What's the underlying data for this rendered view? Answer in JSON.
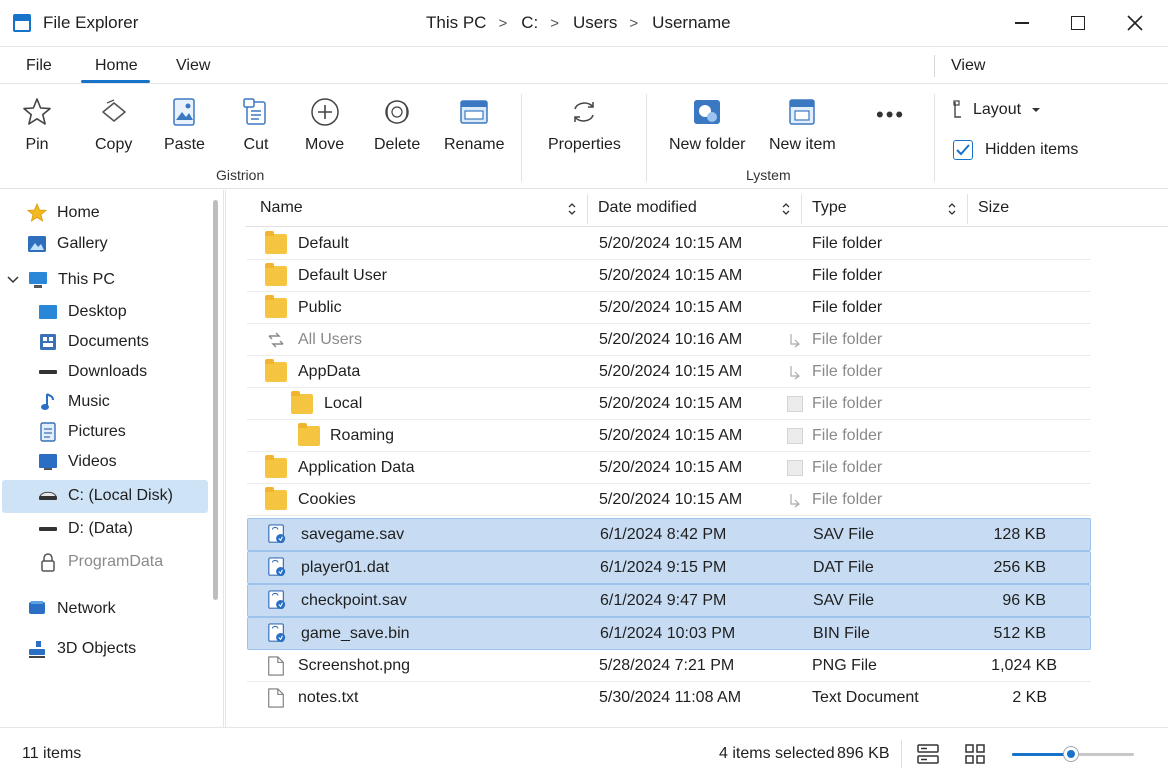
{
  "window": {
    "title": "File Explorer",
    "breadcrumbs": [
      "This PC",
      "C:",
      "Users",
      "Username"
    ],
    "breadcrumb_sep": ">"
  },
  "tabs": {
    "file": "File",
    "home": "Home",
    "view": "View",
    "view_right": "View",
    "active": "Home"
  },
  "ribbon": {
    "buttons": [
      {
        "label": "Pin",
        "icon": "star-icon"
      },
      {
        "label": "Copy",
        "icon": "copy-icon"
      },
      {
        "label": "Paste",
        "icon": "paste-icon"
      },
      {
        "label": "Cut",
        "icon": "cut-icon"
      },
      {
        "label": "Move",
        "icon": "move-icon"
      },
      {
        "label": "Delete",
        "icon": "delete-icon"
      },
      {
        "label": "Rename",
        "icon": "rename-icon"
      },
      {
        "label": "Properties",
        "icon": "properties-icon"
      },
      {
        "label": "New folder",
        "icon": "new-folder-icon"
      },
      {
        "label": "New item",
        "icon": "new-item-icon"
      }
    ],
    "group1_label": "Gistrion",
    "group2_label": "Lystem",
    "more": "•••",
    "layout_label": "Layout",
    "hidden_items_label": "Hidden items",
    "hidden_items_checked": true
  },
  "nav": {
    "items": [
      {
        "label": "Home",
        "icon": "home-star-icon"
      },
      {
        "label": "Gallery",
        "icon": "gallery-icon"
      },
      {
        "label": "This PC",
        "icon": "this-pc-icon"
      },
      {
        "label": "Desktop",
        "icon": "desktop-icon"
      },
      {
        "label": "Documents",
        "icon": "documents-icon"
      },
      {
        "label": "Downloads",
        "icon": "downloads-icon"
      },
      {
        "label": "Music",
        "icon": "music-icon"
      },
      {
        "label": "Pictures",
        "icon": "pictures-icon"
      },
      {
        "label": "Videos",
        "icon": "videos-icon"
      },
      {
        "label": "C: (Local Disk)",
        "icon": "local-disk-icon"
      },
      {
        "label": "D: (Data)",
        "icon": "data-disk-icon"
      },
      {
        "label": "ProgramData",
        "icon": "lock-icon"
      },
      {
        "label": "Network",
        "icon": "network-icon"
      },
      {
        "label": "3D Objects",
        "icon": "3d-objects-icon"
      }
    ],
    "selected": "C: (Local Disk)"
  },
  "columns": {
    "name": "Name",
    "date": "Date modified",
    "type": "Type",
    "size": "Size"
  },
  "files": [
    {
      "name": "Default",
      "date": "5/20/2024 10:15 AM",
      "type": "File folder",
      "size": "",
      "kind": "folder"
    },
    {
      "name": "Default User",
      "date": "5/20/2024 10:15 AM",
      "type": "File folder",
      "size": "",
      "kind": "folder"
    },
    {
      "name": "Public",
      "date": "5/20/2024 10:15 AM",
      "type": "File folder",
      "size": "",
      "kind": "folder"
    },
    {
      "name": "All Users",
      "date": "5/20/2024 10:16 AM",
      "type": "File folder",
      "size": "",
      "kind": "link"
    },
    {
      "name": "AppData",
      "date": "5/20/2024 10:15 AM",
      "type": "File folder",
      "size": "",
      "kind": "folder"
    },
    {
      "name": "Local",
      "date": "5/20/2024 10:15 AM",
      "type": "File folder",
      "size": "",
      "kind": "folder"
    },
    {
      "name": "Roaming",
      "date": "5/20/2024 10:15 AM",
      "type": "File folder",
      "size": "",
      "kind": "folder"
    },
    {
      "name": "Application Data",
      "date": "5/20/2024 10:15 AM",
      "type": "File folder",
      "size": "",
      "kind": "folder"
    },
    {
      "name": "Cookies",
      "date": "5/20/2024 10:15 AM",
      "type": "File folder",
      "size": "",
      "kind": "folder"
    },
    {
      "name": "savegame.sav",
      "date": "6/1/2024 8:42 PM",
      "type": "SAV File",
      "size": "128 KB",
      "kind": "game"
    },
    {
      "name": "player01.dat",
      "date": "6/1/2024 9:15 PM",
      "type": "DAT File",
      "size": "256 KB",
      "kind": "game"
    },
    {
      "name": "checkpoint.sav",
      "date": "6/1/2024 9:47 PM",
      "type": "SAV File",
      "size": "96 KB",
      "kind": "game"
    },
    {
      "name": "game_save.bin",
      "date": "6/1/2024 10:03 PM",
      "type": "BIN File",
      "size": "512 KB",
      "kind": "game"
    },
    {
      "name": "Screenshot.png",
      "date": "5/28/2024 7:21 PM",
      "type": "PNG File",
      "size": "1,024 KB",
      "kind": "doc"
    },
    {
      "name": "notes.txt",
      "date": "5/30/2024 11:08 AM",
      "type": "Text Document",
      "size": "2 KB",
      "kind": "doc"
    }
  ],
  "status": {
    "item_count": "11 items",
    "selected": "4 items selected",
    "selected_size": "896 KB",
    "zoom_level": 0.48
  },
  "colors": {
    "accent": "#1673c9",
    "selection": "#c7dcf3",
    "folder": "#f5c542"
  }
}
